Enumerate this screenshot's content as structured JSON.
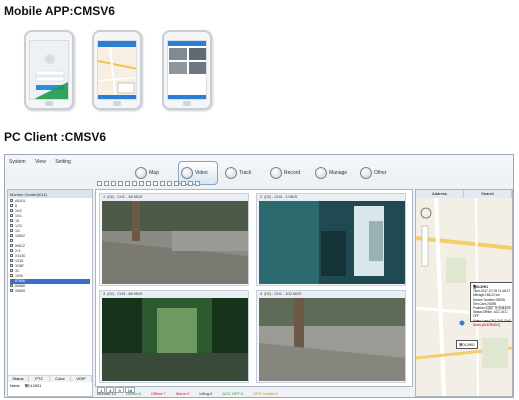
{
  "mobile_title": "Mobile APP:CMSV6",
  "pc_title": "PC Client :CMSV6",
  "menu": [
    "System",
    "View",
    "Setting"
  ],
  "toolbar": [
    {
      "label": "Map",
      "icon": "map-icon"
    },
    {
      "label": "Video",
      "icon": "video-icon",
      "active": true
    },
    {
      "label": "Track",
      "icon": "track-icon"
    },
    {
      "label": "Record",
      "icon": "record-icon"
    },
    {
      "label": "Manage",
      "icon": "manage-icon"
    },
    {
      "label": "Other",
      "icon": "other-icon"
    }
  ],
  "tree": {
    "header": "Monitor Center(6/14)",
    "items": [
      "A81DL",
      "8",
      "10/2",
      "10/1",
      "15",
      "12/3",
      "1/2",
      "15802",
      "",
      "99612",
      "X.5",
      "X3130",
      "V338",
      "3GBF",
      "3X",
      "1000",
      "87646",
      "86888",
      "95659"
    ]
  },
  "left_tabs": [
    "Status",
    "PTZ",
    "Color",
    "VOIP"
  ],
  "left_props": {
    "label": "Name",
    "value": "警DL2H01"
  },
  "cells": [
    {
      "index": "1",
      "caption": "(02) - CH1 - 36 KB/S"
    },
    {
      "index": "2",
      "caption": "(02) - CH3 - 2 KB/S"
    },
    {
      "index": "3",
      "caption": "(02) - CH3 - 88 KB/S"
    },
    {
      "index": "4",
      "caption": "(02) - CH1 - 102 KB/S"
    }
  ],
  "pages": [
    "1",
    "4",
    "9",
    "16"
  ],
  "status": {
    "monitor": "Monitor:13",
    "online": "Online:6",
    "offline": "Offline:7",
    "alarm": "Alarm:0",
    "idling": "Idling:0",
    "acc_off": "ACC OFF:0",
    "gps_invalid": "GPS Invalid:5"
  },
  "right_tabs": [
    "Address",
    "Search"
  ],
  "popup": {
    "title": "警DL2H01",
    "time": "Time:2017-07-09 11:48:27",
    "mileage": "Mileage:168.22 km",
    "device": "Device Number:25298",
    "sim": "Sim Card:25298",
    "position": "Position:中国广东省深圳市",
    "status": "Status:Offline, ACC ACC OFF",
    "video": "Video Loss:CH1,CH2,CH3",
    "alarm": "Alarm:[ADDRMAX]",
    "tag": "警DL2H01"
  }
}
